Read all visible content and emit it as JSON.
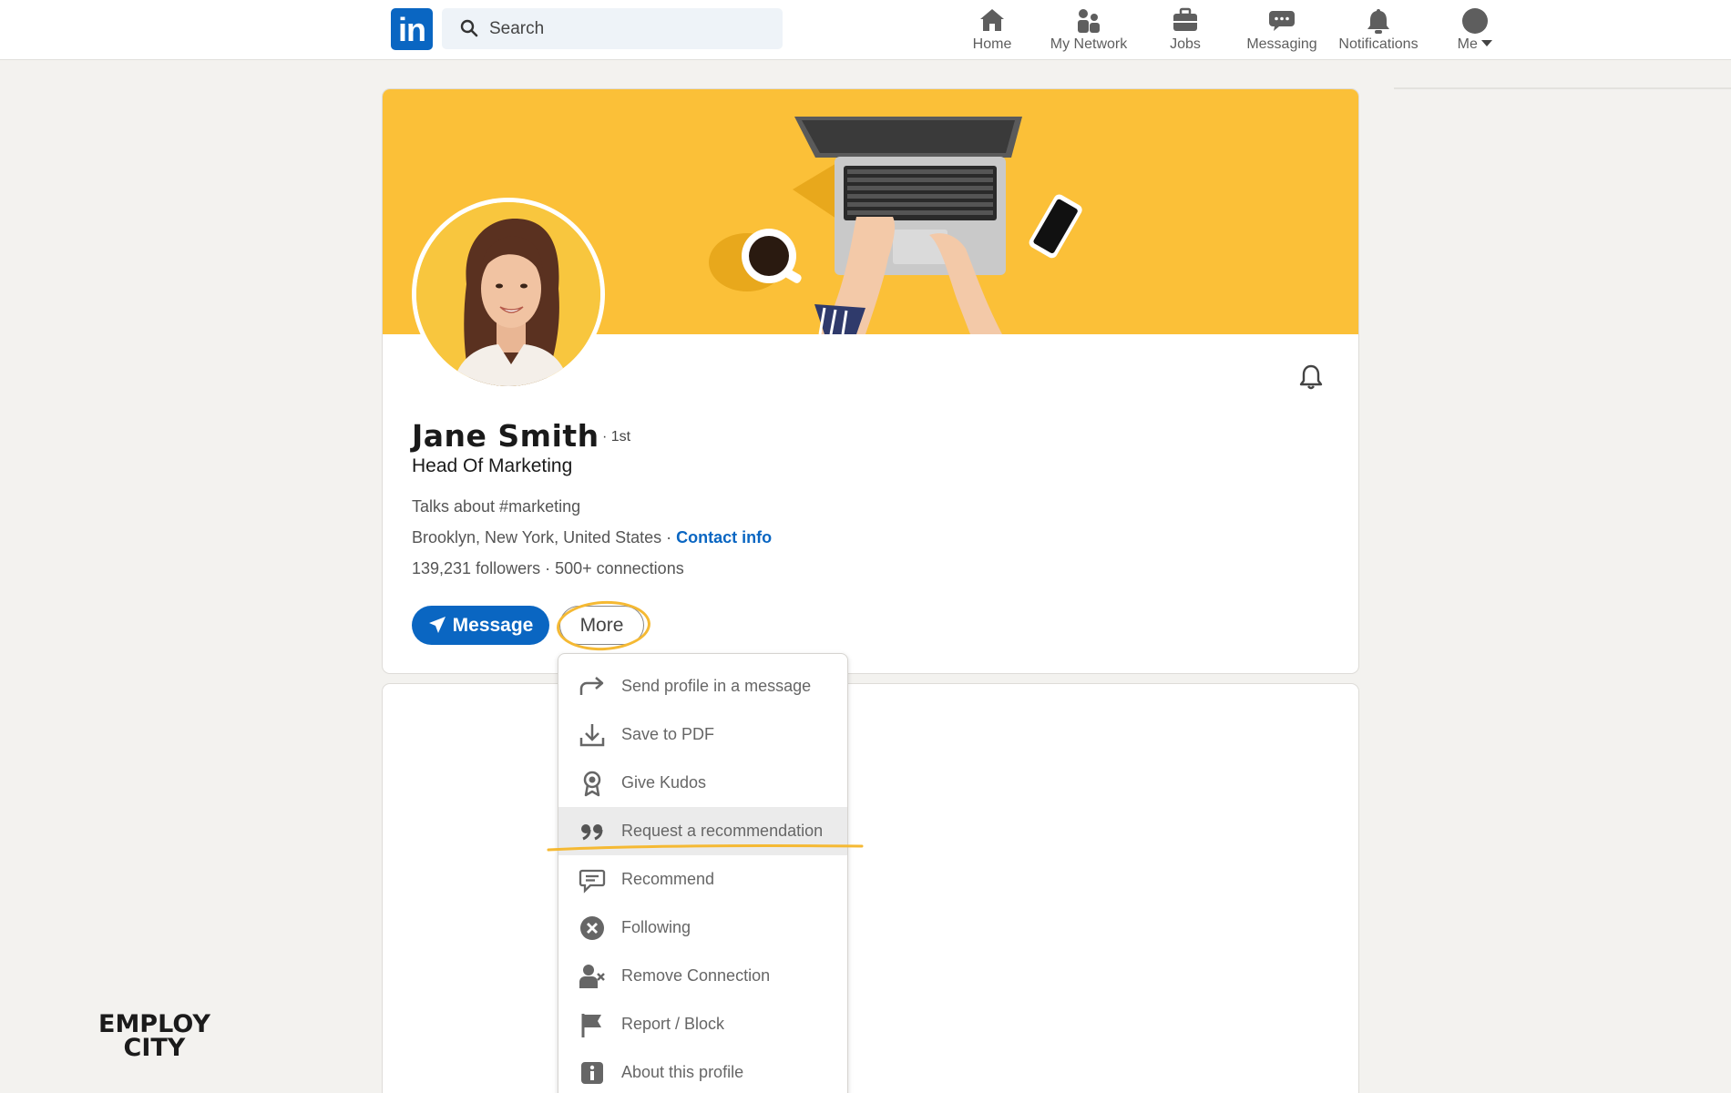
{
  "nav": {
    "logo": "in",
    "search_placeholder": "Search",
    "items": [
      {
        "label": "Home",
        "icon": "home-icon"
      },
      {
        "label": "My Network",
        "icon": "network-icon"
      },
      {
        "label": "Jobs",
        "icon": "briefcase-icon"
      },
      {
        "label": "Messaging",
        "icon": "chat-icon"
      },
      {
        "label": "Notifications",
        "icon": "bell-icon"
      },
      {
        "label": "Me",
        "icon": "avatar-icon"
      }
    ]
  },
  "profile": {
    "name": "Jane Smith",
    "degree": "· 1st",
    "headline": "Head Of Marketing",
    "talks_about": "Talks about #marketing",
    "location": "Brooklyn, New York, United States",
    "location_sep": " · ",
    "contact_info": "Contact info",
    "followers": "139,231 followers",
    "connections": " · 500+ connections",
    "message_button": "Message",
    "more_button": "More"
  },
  "menu": {
    "items": [
      {
        "label": "Send profile in a message",
        "icon": "share-arrow-icon"
      },
      {
        "label": "Save to PDF",
        "icon": "download-icon"
      },
      {
        "label": "Give Kudos",
        "icon": "award-icon"
      },
      {
        "label": "Request a recommendation",
        "icon": "quote-icon"
      },
      {
        "label": "Recommend",
        "icon": "speech-bubble-icon"
      },
      {
        "label": "Following",
        "icon": "x-circle-icon"
      },
      {
        "label": "Remove Connection",
        "icon": "remove-person-icon"
      },
      {
        "label": "Report / Block",
        "icon": "flag-icon"
      },
      {
        "label": "About this profile",
        "icon": "info-icon"
      }
    ]
  },
  "watermark": {
    "line1": "EMPLOY",
    "line2": "CITY"
  },
  "colors": {
    "brand_blue": "#0a66c2",
    "banner_yellow": "#fbc038",
    "highlight": "#f5b933"
  }
}
